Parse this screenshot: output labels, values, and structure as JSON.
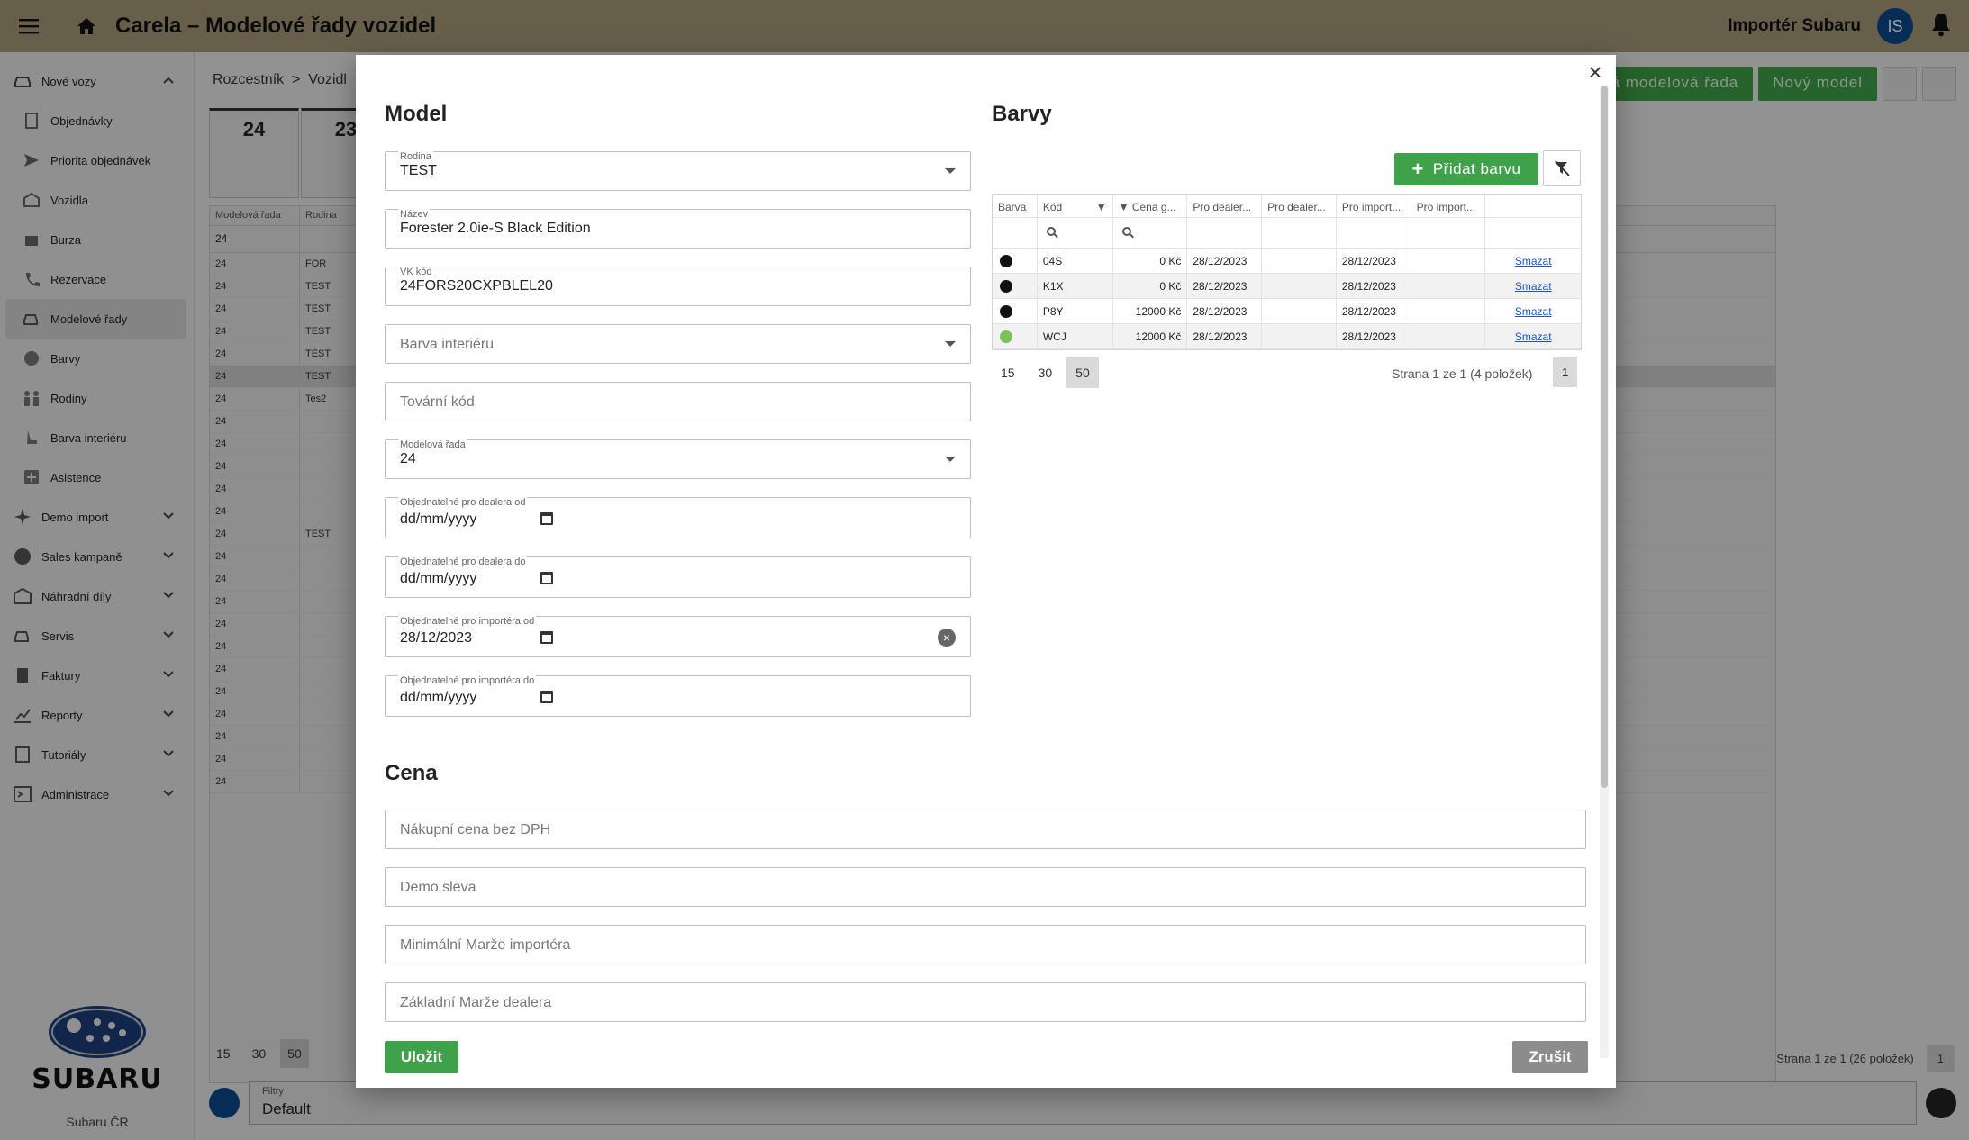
{
  "app": {
    "title": "Carela – Modelové řady vozidel",
    "user_name": "Importér Subaru",
    "user_initials": "IS"
  },
  "sidebar": {
    "items": [
      {
        "label": "Nové vozy",
        "expanded": true
      },
      {
        "label": "Objednávky"
      },
      {
        "label": "Priorita objednávek"
      },
      {
        "label": "Vozidla"
      },
      {
        "label": "Burza"
      },
      {
        "label": "Rezervace"
      },
      {
        "label": "Modelové řady",
        "active": true
      },
      {
        "label": "Barvy"
      },
      {
        "label": "Rodiny"
      },
      {
        "label": "Barva interiéru"
      },
      {
        "label": "Asistence"
      },
      {
        "label": "Demo import"
      },
      {
        "label": "Sales kampaně"
      },
      {
        "label": "Náhradní díly"
      },
      {
        "label": "Servis"
      },
      {
        "label": "Faktury"
      },
      {
        "label": "Reporty"
      },
      {
        "label": "Tutoriály"
      },
      {
        "label": "Administrace"
      }
    ],
    "logo_text": "SUBARU",
    "footer": "Subaru ČR"
  },
  "background": {
    "breadcrumb_root": "Rozcestník",
    "breadcrumb_sep": ">",
    "breadcrumb_current": "Vozidl",
    "cards": [
      "24",
      "23"
    ],
    "btn_new_series": "á modelová řada",
    "btn_new_model": "Nový model",
    "table_headers": [
      "Modelová řada",
      "Rodina"
    ],
    "filter_value": "24",
    "rows": [
      [
        "24",
        "FOR"
      ],
      [
        "24",
        "TEST"
      ],
      [
        "24",
        "TEST"
      ],
      [
        "24",
        "TEST"
      ],
      [
        "24",
        "TEST"
      ],
      [
        "24",
        "TEST"
      ],
      [
        "24",
        "Tes2"
      ],
      [
        "24",
        ""
      ],
      [
        "24",
        ""
      ],
      [
        "24",
        ""
      ],
      [
        "24",
        ""
      ],
      [
        "24",
        ""
      ],
      [
        "24",
        "TEST"
      ],
      [
        "24",
        ""
      ],
      [
        "24",
        ""
      ],
      [
        "24",
        ""
      ],
      [
        "24",
        ""
      ],
      [
        "24",
        ""
      ],
      [
        "24",
        ""
      ],
      [
        "24",
        ""
      ],
      [
        "24",
        ""
      ],
      [
        "24",
        ""
      ],
      [
        "24",
        ""
      ],
      [
        "24",
        ""
      ]
    ],
    "pager_sizes": [
      "15",
      "30",
      "50"
    ],
    "pager_info": "Strana 1 ze 1 (26 položek)",
    "pager_page": "1",
    "filter_label": "Filtry",
    "filter_selected": "Default"
  },
  "modal": {
    "model_title": "Model",
    "colors_title": "Barvy",
    "price_title": "Cena",
    "fields": {
      "rodina": {
        "label": "Rodina",
        "value": "TEST"
      },
      "nazev": {
        "label": "Název",
        "value": "Forester 2.0ie-S Black Edition"
      },
      "vk_kod": {
        "label": "VK kód",
        "value": "24FORS20CXPBLEL20"
      },
      "barva_interieru": {
        "placeholder": "Barva interiéru"
      },
      "tovarni_kod": {
        "placeholder": "Tovární kód"
      },
      "modelova_rada": {
        "label": "Modelová řada",
        "value": "24"
      },
      "dealer_od": {
        "label": "Objednatelné pro dealera od",
        "value": "dd/mm/yyyy"
      },
      "dealer_do": {
        "label": "Objednatelné pro dealera do",
        "value": "dd/mm/yyyy"
      },
      "importer_od": {
        "label": "Objednatelné pro importéra od",
        "value": "28/12/2023"
      },
      "importer_do": {
        "label": "Objednatelné pro importéra do",
        "value": "dd/mm/yyyy"
      }
    },
    "price_fields": {
      "nakupni": "Nákupní cena bez DPH",
      "demo": "Demo sleva",
      "min_marze": "Minimální Marže importéra",
      "zakl_marze": "Základní Marže dealera"
    },
    "add_color_label": "Přidat barvu",
    "colors_table": {
      "headers": [
        "Barva",
        "Kód",
        "Cena g...",
        "Pro dealer...",
        "Pro dealer...",
        "Pro import...",
        "Pro import...",
        ""
      ],
      "rows": [
        {
          "color": "#111111",
          "code": "04S",
          "price": "0 Kč",
          "dealer_from": "28/12/2023",
          "dealer_to": "",
          "imp_from": "28/12/2023",
          "imp_to": "",
          "action": "Smazat"
        },
        {
          "color": "#111111",
          "code": "K1X",
          "price": "0 Kč",
          "dealer_from": "28/12/2023",
          "dealer_to": "",
          "imp_from": "28/12/2023",
          "imp_to": "",
          "action": "Smazat"
        },
        {
          "color": "#111111",
          "code": "P8Y",
          "price": "12000 Kč",
          "dealer_from": "28/12/2023",
          "dealer_to": "",
          "imp_from": "28/12/2023",
          "imp_to": "",
          "action": "Smazat"
        },
        {
          "color": "#7cc25a",
          "code": "WCJ",
          "price": "12000 Kč",
          "dealer_from": "28/12/2023",
          "dealer_to": "",
          "imp_from": "28/12/2023",
          "imp_to": "",
          "action": "Smazat"
        }
      ]
    },
    "colors_pager": {
      "sizes": [
        "15",
        "30",
        "50"
      ],
      "info": "Strana 1 ze 1 (4 položek)",
      "page": "1"
    },
    "save_label": "Uložit",
    "cancel_label": "Zrušit",
    "close_glyph": "×"
  },
  "colors": {
    "topbar": "#a8997a",
    "accent_green": "#3fa14a",
    "avatar_blue": "#0b4a8b"
  }
}
